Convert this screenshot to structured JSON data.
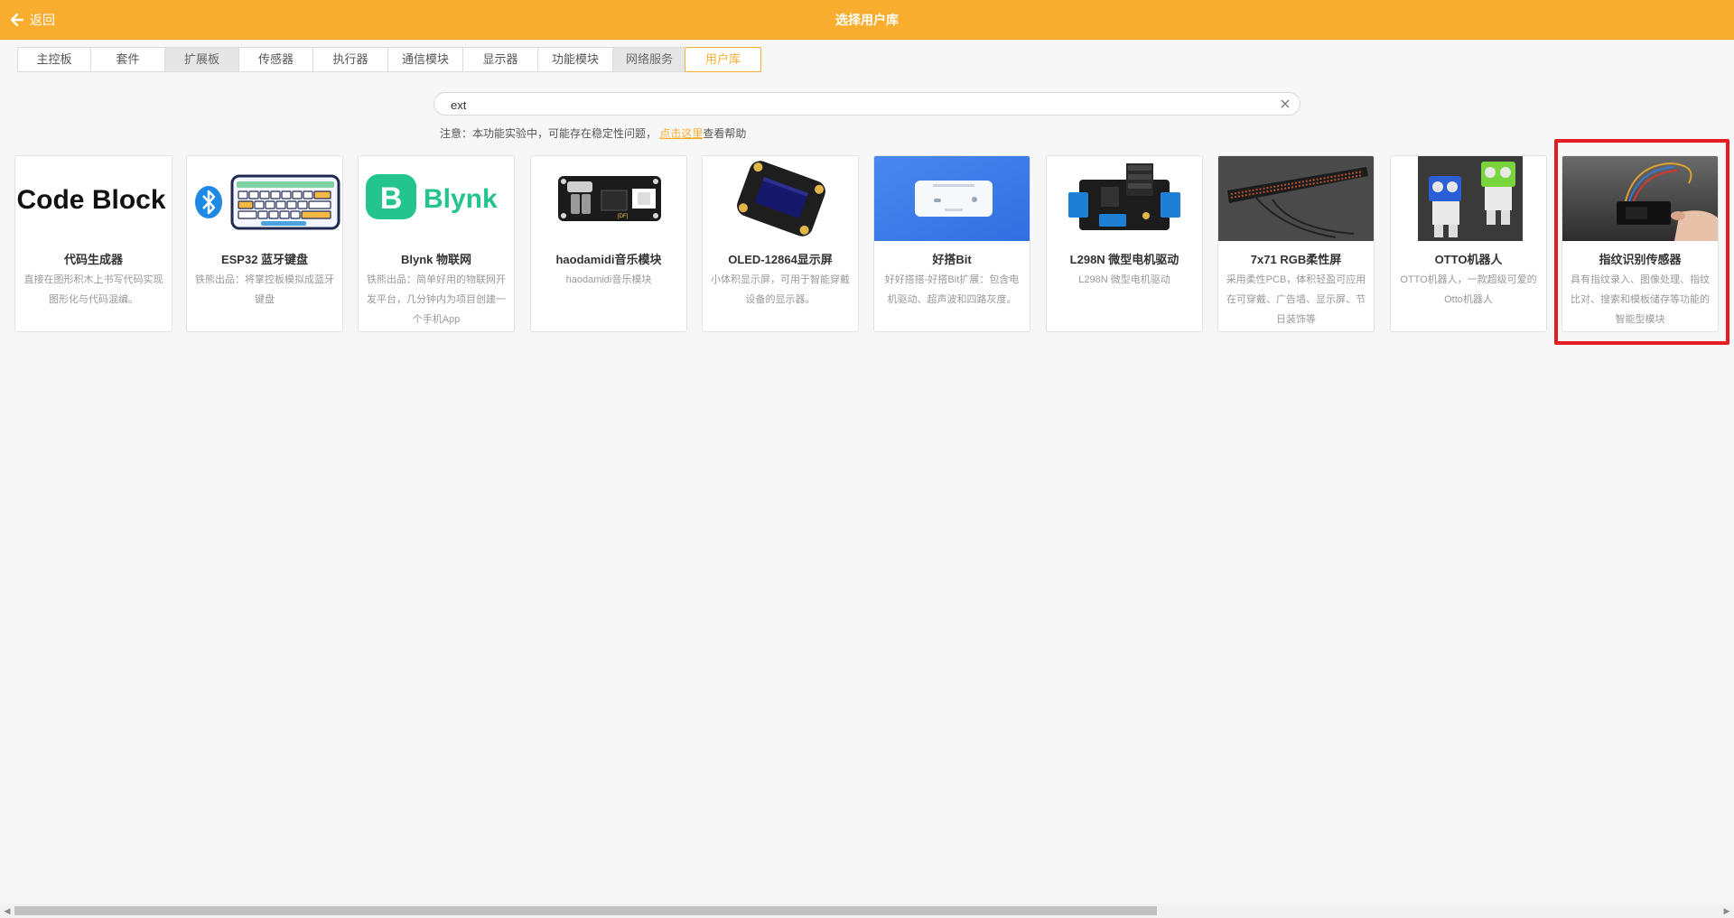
{
  "header": {
    "back_label": "返回",
    "title": "选择用户库",
    "background": "#f9ad2f"
  },
  "tabs": [
    {
      "label": "主控板",
      "state": "normal"
    },
    {
      "label": "套件",
      "state": "normal"
    },
    {
      "label": "扩展板",
      "state": "gray"
    },
    {
      "label": "传感器",
      "state": "normal"
    },
    {
      "label": "执行器",
      "state": "normal"
    },
    {
      "label": "通信模块",
      "state": "normal"
    },
    {
      "label": "显示器",
      "state": "normal"
    },
    {
      "label": "功能模块",
      "state": "normal"
    },
    {
      "label": "网络服务",
      "state": "gray"
    },
    {
      "label": "用户库",
      "state": "active"
    }
  ],
  "search": {
    "value": "ext",
    "placeholder": ""
  },
  "notice": {
    "prefix": "注意：本功能实验中，可能存在稳定性问题，",
    "link": "点击这里",
    "suffix": "查看帮助"
  },
  "cards": [
    {
      "title": "代码生成器",
      "desc": "直接在图形积木上书写代码实现图形化与代码混编。",
      "thumb": "code-block-logo",
      "thumb_text": "Code Block"
    },
    {
      "title": "ESP32 蓝牙键盘",
      "desc": "铁熊出品：将掌控板模拟成蓝牙键盘",
      "thumb": "bluetooth-keyboard"
    },
    {
      "title": "Blynk 物联网",
      "desc": "铁熊出品：简单好用的物联网开发平台，几分钟内为项目创建一个手机App",
      "thumb": "blynk-logo",
      "thumb_letter": "B",
      "thumb_text": "Blynk"
    },
    {
      "title": "haodamidi音乐模块",
      "desc": "haodamidi音乐模块",
      "thumb": "midi-module"
    },
    {
      "title": "OLED-12864显示屏",
      "desc": "小体积显示屏，可用于智能穿戴设备的显示器。",
      "thumb": "oled-display"
    },
    {
      "title": "好搭Bit",
      "desc": "好好搭搭-好搭Bit扩展：包含电机驱动、超声波和四路灰度。",
      "thumb": "haoda-board"
    },
    {
      "title": "L298N 微型电机驱动",
      "desc": "L298N 微型电机驱动",
      "thumb": "motor-driver"
    },
    {
      "title": "7x71 RGB柔性屏",
      "desc": "采用柔性PCB，体积轻盈可应用在可穿戴、广告墙、显示屏、节日装饰等",
      "thumb": "flexible-led-strip"
    },
    {
      "title": "OTTO机器人",
      "desc": "OTTO机器人，一款超级可爱的Otto机器人",
      "thumb": "otto-robot"
    },
    {
      "title": "指纹识别传感器",
      "desc": "具有指纹录入、图像处理、指纹比对、搜索和模板储存等功能的智能型模块",
      "thumb": "fingerprint-sensor"
    }
  ],
  "colors": {
    "accent": "#f9ad2f",
    "highlight": "#e41c24",
    "blynk_green": "#23c48e",
    "haoda_blue": "#4a88f0"
  }
}
